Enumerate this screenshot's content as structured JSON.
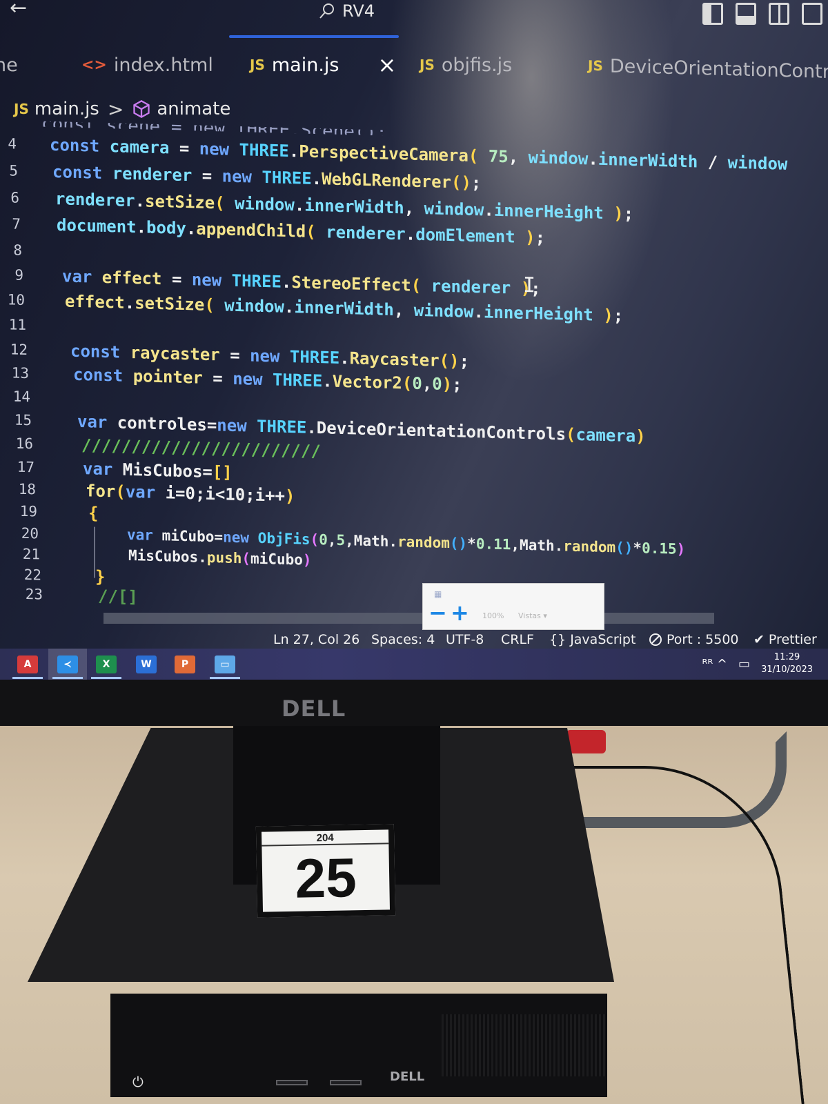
{
  "window": {
    "title": "RV4"
  },
  "tabs": [
    {
      "label": "ne",
      "icon": "html-icon"
    },
    {
      "label": "index.html",
      "icon": "html-icon"
    },
    {
      "label": "main.js",
      "icon": "js-icon",
      "active": true,
      "close": "×"
    },
    {
      "label": "objfis.js",
      "icon": "js-icon"
    },
    {
      "label": "DeviceOrientationControls.",
      "icon": "js-icon"
    }
  ],
  "badges": {
    "js": "JS",
    "html": "<>"
  },
  "breadcrumb": {
    "file": "main.js",
    "separator": ">",
    "symbol": "animate"
  },
  "code": {
    "cut_line": "const scene = new THREE.Scene();",
    "lines": [
      {
        "n": "4",
        "text": "const camera = new THREE.PerspectiveCamera( 75, window.innerWidth / window"
      },
      {
        "n": "5",
        "text": "const renderer = new THREE.WebGLRenderer();"
      },
      {
        "n": "6",
        "text": "renderer.setSize( window.innerWidth, window.innerHeight );"
      },
      {
        "n": "7",
        "text": "document.body.appendChild( renderer.domElement );"
      },
      {
        "n": "8",
        "text": ""
      },
      {
        "n": "9",
        "text": "var effect = new THREE.StereoEffect( renderer );"
      },
      {
        "n": "10",
        "text": "effect.setSize( window.innerWidth, window.innerHeight );"
      },
      {
        "n": "11",
        "text": ""
      },
      {
        "n": "12",
        "text": "const raycaster = new THREE.Raycaster();"
      },
      {
        "n": "13",
        "text": "const pointer = new THREE.Vector2(0,0);"
      },
      {
        "n": "14",
        "text": ""
      },
      {
        "n": "15",
        "text": "var controles=new THREE.DeviceOrientationControls(camera)"
      },
      {
        "n": "16",
        "text": "////////////////////////"
      },
      {
        "n": "17",
        "text": "var MisCubos=[]"
      },
      {
        "n": "18",
        "text": "for(var i=0;i<10;i++)"
      },
      {
        "n": "19",
        "text": "{"
      },
      {
        "n": "20",
        "text": "var miCubo=new ObjFis(0,5,Math.random()*0.11,Math.random()*0.15)"
      },
      {
        "n": "21",
        "text": "MisCubos.push(miCubo)"
      },
      {
        "n": "22",
        "text": "}"
      },
      {
        "n": "23",
        "text": "//[]"
      }
    ]
  },
  "zoom_popup": {
    "minus": "−",
    "plus": "+",
    "level": "100%",
    "views": "Vistas ▾"
  },
  "statusbar": {
    "position": "Ln 27, Col 26",
    "spaces": "Spaces: 4",
    "encoding": "UTF-8",
    "eol": "CRLF",
    "language": "JavaScript",
    "port": "Port : 5500",
    "formatter": "Prettier"
  },
  "taskbar": {
    "apps": [
      {
        "name": "acrobat",
        "glyph": "A",
        "color": "#d63b3b"
      },
      {
        "name": "vscode",
        "glyph": "≺",
        "color": "#2d8fe6",
        "active": true
      },
      {
        "name": "excel",
        "glyph": "X",
        "color": "#1e8f4e"
      },
      {
        "name": "word",
        "glyph": "W",
        "color": "#2b6fd6"
      },
      {
        "name": "powerpoint",
        "glyph": "P",
        "color": "#e06a37"
      },
      {
        "name": "remote",
        "glyph": "▭",
        "color": "#5ea8e8"
      }
    ],
    "clock_time": "11:29",
    "clock_date": "31/10/2023",
    "tray_symbols": "ᴿᴿ ^"
  },
  "scene": {
    "monitor_logo": "DELL",
    "pc_logo": "DELL",
    "label_small": "204",
    "label_big": "25"
  }
}
